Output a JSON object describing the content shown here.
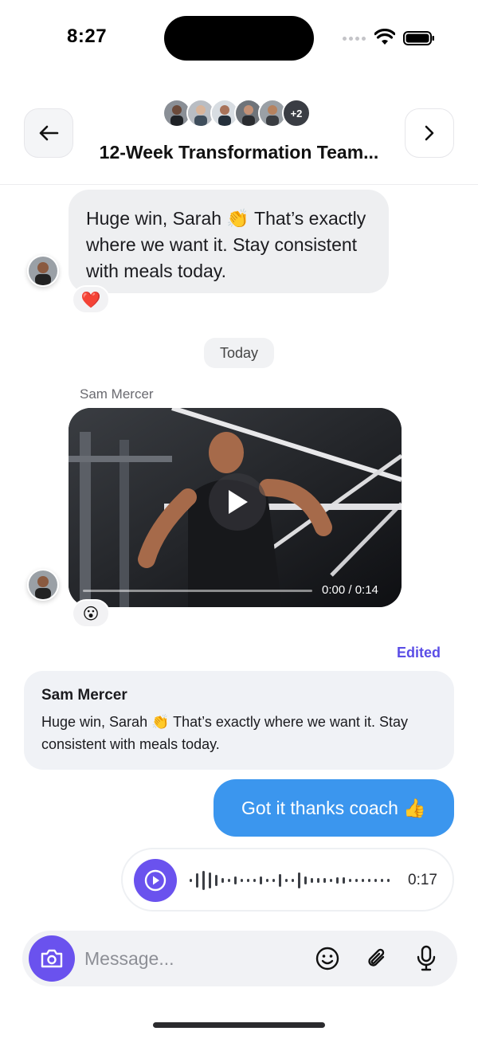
{
  "status_bar": {
    "time": "8:27"
  },
  "header": {
    "title": "12-Week Transformation Team...",
    "member_overflow": "+2",
    "back_icon": "arrow-left-icon",
    "next_icon": "chevron-right-icon"
  },
  "messages": {
    "message_1": {
      "text": "Huge win, Sarah 👏 That’s exactly where we want it. Stay consistent with meals today.",
      "reaction": "❤️"
    },
    "date_separator": "Today",
    "video_message": {
      "sender": "Sam Mercer",
      "time": "0:00 / 0:14",
      "reaction": "😮"
    },
    "edited_label": "Edited",
    "reply_quote": {
      "sender": "Sam Mercer",
      "text": "Huge win, Sarah 👏 That’s exactly where we want it. Stay consistent with meals today."
    },
    "outgoing": {
      "text": "Got it thanks coach 👍"
    },
    "voice_note": {
      "duration": "0:17"
    }
  },
  "composer": {
    "placeholder": "Message...",
    "icons": [
      "camera-icon",
      "emoji-icon",
      "paperclip-icon",
      "microphone-icon"
    ]
  },
  "colors": {
    "accent": "#6a52ee",
    "outgoing_bubble": "#3b96ee",
    "incoming_bubble": "#eeeff1",
    "edited": "#5b4ee6"
  }
}
